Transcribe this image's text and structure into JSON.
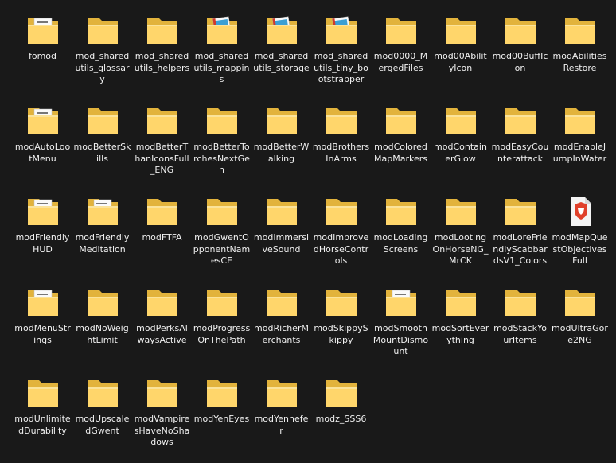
{
  "explorer": {
    "items": [
      {
        "name": "fomod",
        "icon": "folder-with-document-icon",
        "variant": "doc"
      },
      {
        "name": "mod_sharedutils_glossary",
        "icon": "folder-icon",
        "variant": "plain"
      },
      {
        "name": "mod_sharedutils_helpers",
        "icon": "folder-icon",
        "variant": "plain"
      },
      {
        "name": "mod_sharedutils_mappins",
        "icon": "folder-with-image-icon",
        "variant": "image"
      },
      {
        "name": "mod_sharedutils_storage",
        "icon": "folder-with-image-icon",
        "variant": "image"
      },
      {
        "name": "mod_sharedutils_tiny_bootstrapper",
        "icon": "folder-with-image-icon",
        "variant": "image"
      },
      {
        "name": "mod0000_MergedFiles",
        "icon": "folder-icon",
        "variant": "plain"
      },
      {
        "name": "mod00AbilityIcon",
        "icon": "folder-icon",
        "variant": "plain"
      },
      {
        "name": "mod00BuffIcon",
        "icon": "folder-icon",
        "variant": "plain"
      },
      {
        "name": "modAbilitiesRestore",
        "icon": "folder-icon",
        "variant": "plain"
      },
      {
        "name": "modAutoLootMenu",
        "icon": "folder-with-document-icon",
        "variant": "doc"
      },
      {
        "name": "modBetterSkills",
        "icon": "folder-icon",
        "variant": "plain"
      },
      {
        "name": "modBetterThanIconsFull_ENG",
        "icon": "folder-icon",
        "variant": "plain"
      },
      {
        "name": "modBetterTorchesNextGen",
        "icon": "folder-icon",
        "variant": "plain"
      },
      {
        "name": "modBetterWalking",
        "icon": "folder-icon",
        "variant": "plain"
      },
      {
        "name": "modBrothersInArms",
        "icon": "folder-icon",
        "variant": "plain"
      },
      {
        "name": "modColoredMapMarkers",
        "icon": "folder-icon",
        "variant": "plain"
      },
      {
        "name": "modContainerGlow",
        "icon": "folder-icon",
        "variant": "plain"
      },
      {
        "name": "modEasyCounterattack",
        "icon": "folder-icon",
        "variant": "plain"
      },
      {
        "name": "modEnableJumpInWater",
        "icon": "folder-icon",
        "variant": "plain"
      },
      {
        "name": "modFriendlyHUD",
        "icon": "folder-with-document-icon",
        "variant": "doc"
      },
      {
        "name": "modFriendlyMeditation",
        "icon": "folder-with-document-icon",
        "variant": "doc"
      },
      {
        "name": "modFTFA",
        "icon": "folder-icon",
        "variant": "plain"
      },
      {
        "name": "modGwentOpponentNamesCE",
        "icon": "folder-icon",
        "variant": "plain"
      },
      {
        "name": "modImmersiveSound",
        "icon": "folder-icon",
        "variant": "plain"
      },
      {
        "name": "modImprovedHorseControls",
        "icon": "folder-icon",
        "variant": "plain"
      },
      {
        "name": "modLoadingScreens",
        "icon": "folder-icon",
        "variant": "plain"
      },
      {
        "name": "modLootingOnHorseNG_MrCK",
        "icon": "folder-icon",
        "variant": "plain"
      },
      {
        "name": "modLoreFriendlyScabbardsV1_Colors",
        "icon": "folder-icon",
        "variant": "plain"
      },
      {
        "name": "modMapQuestObjectivesFull",
        "icon": "brave-browser-file-icon",
        "variant": "brave"
      },
      {
        "name": "modMenuStrings",
        "icon": "folder-with-document-icon",
        "variant": "doc"
      },
      {
        "name": "modNoWeightLimit",
        "icon": "folder-icon",
        "variant": "plain"
      },
      {
        "name": "modPerksAlwaysActive",
        "icon": "folder-icon",
        "variant": "plain"
      },
      {
        "name": "modProgressOnThePath",
        "icon": "folder-icon",
        "variant": "plain"
      },
      {
        "name": "modRicherMerchants",
        "icon": "folder-icon",
        "variant": "plain"
      },
      {
        "name": "modSkippySkippy",
        "icon": "folder-icon",
        "variant": "plain"
      },
      {
        "name": "modSmoothMountDismount",
        "icon": "folder-with-document-icon",
        "variant": "doc"
      },
      {
        "name": "modSortEverything",
        "icon": "folder-icon",
        "variant": "plain"
      },
      {
        "name": "modStackYourItems",
        "icon": "folder-icon",
        "variant": "plain"
      },
      {
        "name": "modUltraGore2NG",
        "icon": "folder-icon",
        "variant": "plain"
      },
      {
        "name": "modUnlimitedDurability",
        "icon": "folder-icon",
        "variant": "plain"
      },
      {
        "name": "modUpscaledGwent",
        "icon": "folder-icon",
        "variant": "plain"
      },
      {
        "name": "modVampiresHaveNoShadows",
        "icon": "folder-icon",
        "variant": "plain"
      },
      {
        "name": "modYenEyes",
        "icon": "folder-icon",
        "variant": "plain"
      },
      {
        "name": "modYennefer",
        "icon": "folder-icon",
        "variant": "plain"
      },
      {
        "name": "modz_SSS6",
        "icon": "folder-icon",
        "variant": "plain"
      }
    ]
  },
  "colors": {
    "background": "#191919",
    "text": "#f0f0f0",
    "folder_back": "#e2b33c",
    "folder_front": "#ffd66b",
    "brave_red": "#e0402a"
  }
}
